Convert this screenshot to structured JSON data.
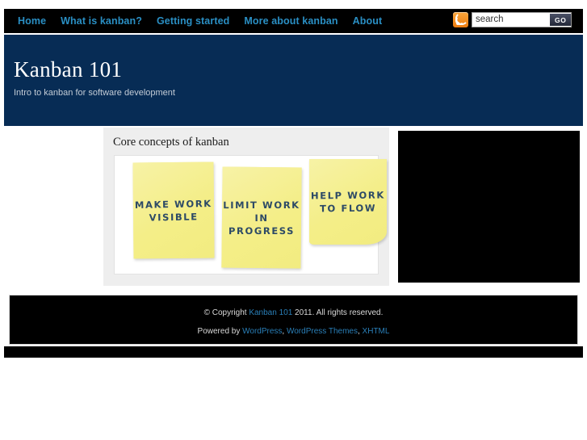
{
  "nav": {
    "items": [
      {
        "label": "Home",
        "name": "nav-link-home"
      },
      {
        "label": "What is kanban?",
        "name": "nav-link-what-is-kanban"
      },
      {
        "label": "Getting started",
        "name": "nav-link-getting-started"
      },
      {
        "label": "More about kanban",
        "name": "nav-link-more-about-kanban"
      },
      {
        "label": "About",
        "name": "nav-link-about"
      }
    ]
  },
  "search": {
    "placeholder": "search",
    "value": "search",
    "button_label": "GO",
    "rss_icon": "rss-feed-icon"
  },
  "header": {
    "title": "Kanban 101",
    "tagline": "Intro to kanban for software development"
  },
  "main": {
    "card_title": "Core concepts of kanban",
    "notes": [
      {
        "lines": "MAKE WORK VISIBLE"
      },
      {
        "lines": "LIMIT WORK IN PROGRESS"
      },
      {
        "lines": "HELP WORK TO FLOW"
      }
    ]
  },
  "footer": {
    "copyright_prefix": "© Copyright ",
    "copyright_link": "Kanban 101",
    "copyright_suffix": " 2011. All rights reserved.",
    "powered_prefix": "Powered by ",
    "powered_links": [
      {
        "label": "WordPress"
      },
      {
        "label": "WordPress Themes"
      },
      {
        "label": "XHTML"
      }
    ],
    "separator": ", "
  },
  "colors": {
    "nav_bg": "#000000",
    "nav_link": "#2a8fc4",
    "banner_top": "#0b3361",
    "banner_bottom": "#021220",
    "note_yellow": "#f5f094",
    "note_text": "#2d4a66",
    "card_bg": "#eeeeee",
    "footer_link": "#2a7fb8",
    "rss_orange": "#ee7d10"
  }
}
